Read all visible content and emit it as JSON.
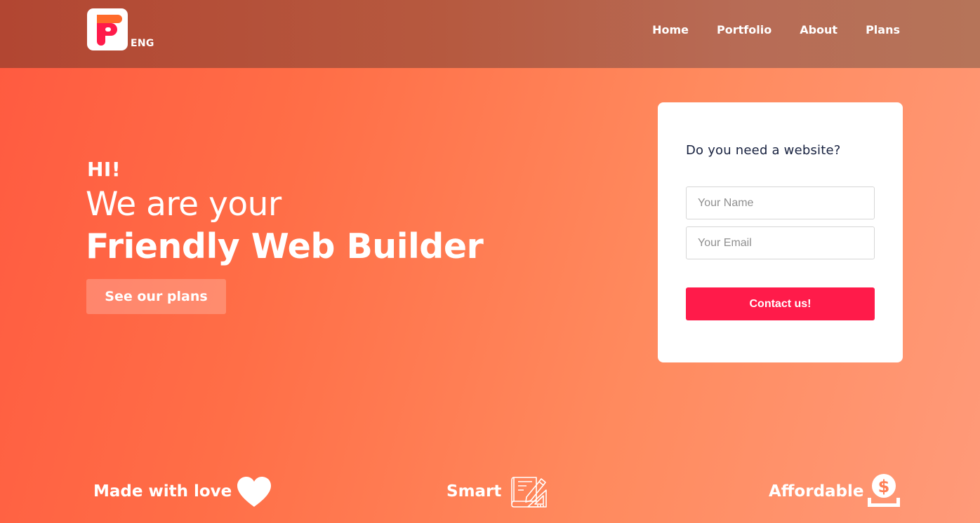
{
  "brand": {
    "logo_letter": "F",
    "language": "ENG",
    "colors": {
      "logo_orange": "#ff6a2a",
      "logo_pink": "#ff1b4a"
    }
  },
  "nav": {
    "items": [
      {
        "label": "Home"
      },
      {
        "label": "Portfolio"
      },
      {
        "label": "About"
      },
      {
        "label": "Plans"
      }
    ]
  },
  "hero": {
    "greeting": "HI!",
    "line1": "We are your",
    "line2": "Friendly Web Builder",
    "cta_label": "See our plans"
  },
  "contact_card": {
    "title": "Do you need a website?",
    "name_placeholder": "Your Name",
    "email_placeholder": "Your Email",
    "submit_label": "Contact us!",
    "accent_color": "#ff1b4a"
  },
  "features": [
    {
      "label": "Made with love",
      "icon": "heart-icon"
    },
    {
      "label": "Smart",
      "icon": "blueprint-icon"
    },
    {
      "label": "Affordable",
      "icon": "money-icon"
    }
  ]
}
